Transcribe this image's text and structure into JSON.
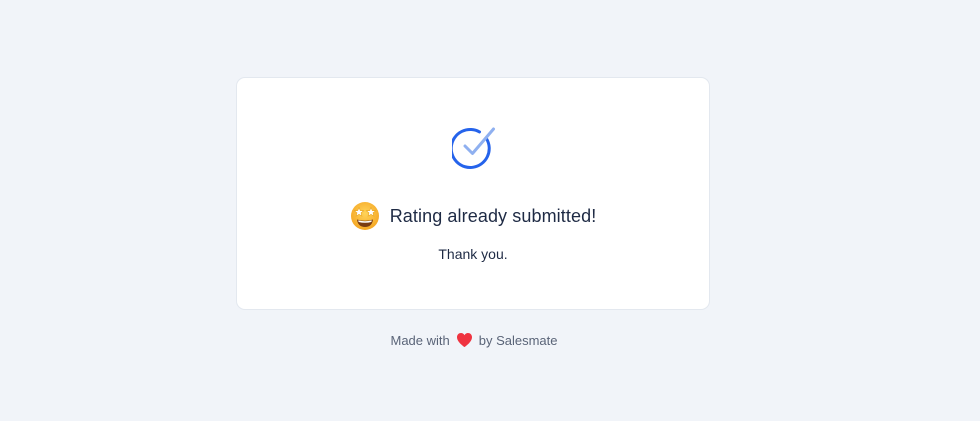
{
  "card": {
    "title": "Rating already submitted!",
    "subtitle": "Thank you.",
    "status_icon": "check-circle-icon",
    "emoji_icon": "star-struck-emoji-icon"
  },
  "footer": {
    "made_with": "Made with",
    "by_text": "by Salesmate",
    "heart_icon": "heart-icon"
  },
  "colors": {
    "background": "#f1f4f9",
    "accent_blue": "#2563eb",
    "light_blue": "#8fb0f0",
    "heart_red": "#ef3340",
    "text_dark": "#1e2a44",
    "text_muted": "#5a6478"
  }
}
